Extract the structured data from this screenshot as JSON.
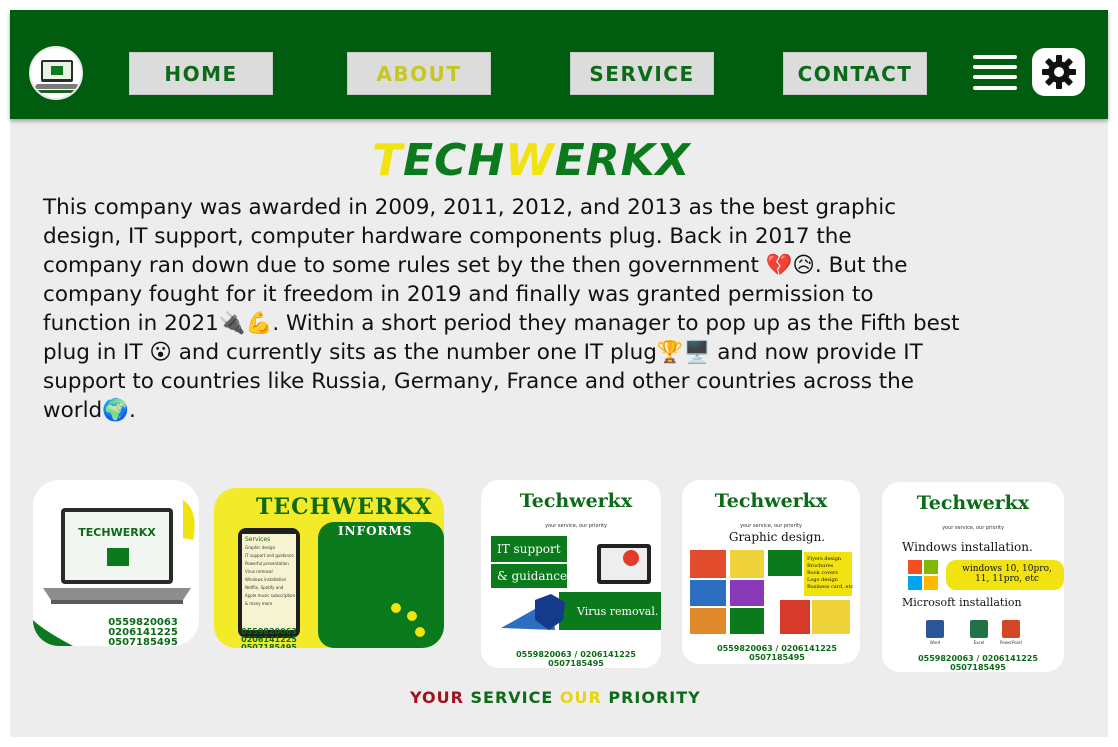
{
  "nav": {
    "home": "Home",
    "about": "About",
    "service": "Service",
    "contact": "Contact"
  },
  "brand": {
    "part1": "T",
    "part2": "ECH",
    "part3": "W",
    "part4": "ERKX"
  },
  "about_text": "This company was awarded in 2009, 2011, 2012, and 2013 as the best graphic\ndesign, IT support, computer hardware components plug.  Back in 2017 the\ncompany ran down due to some rules set by the then government 💔😥. But the\ncompany fought for it freedom in 2019 and finally was granted permission to\nfunction in 2021🔌💪. Within a short period they manager to pop up as the Fifth best\nplug in IT  😮 and currently sits as the number one IT plug🏆🖥️ and now provide IT\nsupport to countries like Russia, Germany, France and other countries across the\nworld🌍.",
  "cards": [
    {
      "title": "TECHWERKX",
      "lines": [],
      "phones": "0559820063\n0206141225\n0507185495"
    },
    {
      "title": "TECHWERKX",
      "subtitle": "INFORMS",
      "lines": [
        "Services",
        "Graphic design",
        "IT support and guidance",
        "Powerful presentation",
        "Virus removal",
        "Windows installation",
        "Netflix, Spotify and",
        "Apple music subscription",
        "& many more"
      ],
      "phones": "0559820063\n0206141225\n0507185495"
    },
    {
      "title": "Techwerkx",
      "tag": "your service, our priority",
      "lines": [
        "IT support",
        "& guidance.",
        "Virus removal."
      ],
      "phones": "0559820063 / 0206141225\n0507185495"
    },
    {
      "title": "Techwerkx",
      "tag": "your service, our priority",
      "lines": [
        "Graphic design.",
        "Flyers design",
        "Brochures",
        "Book covers",
        "Logo design",
        "Business card, etc"
      ],
      "phones": "0559820063 / 0206141225\n0507185495"
    },
    {
      "title": "Techwerkx",
      "tag": "your service, our priority",
      "lines": [
        "Windows installation.",
        "windows 10, 10pro,",
        "11, 11pro, etc",
        "Microsoft installation",
        "Word",
        "Excel",
        "PowerPoint"
      ],
      "phones": "0559820063 / 0206141225\n0507185495"
    }
  ],
  "tagline": {
    "w1": "YOUR",
    "w2": "SERVICE",
    "w3": "OUR",
    "w4": "PRIORITY"
  },
  "colors": {
    "nav_green": "#005d10",
    "brand_yellow": "#f1e30f",
    "brand_green": "#0b7a1c",
    "tag_red": "#a0111b"
  },
  "icons": {
    "menu": "hamburger-menu-icon",
    "settings": "gear-icon",
    "logo": "laptop-logo-icon"
  }
}
